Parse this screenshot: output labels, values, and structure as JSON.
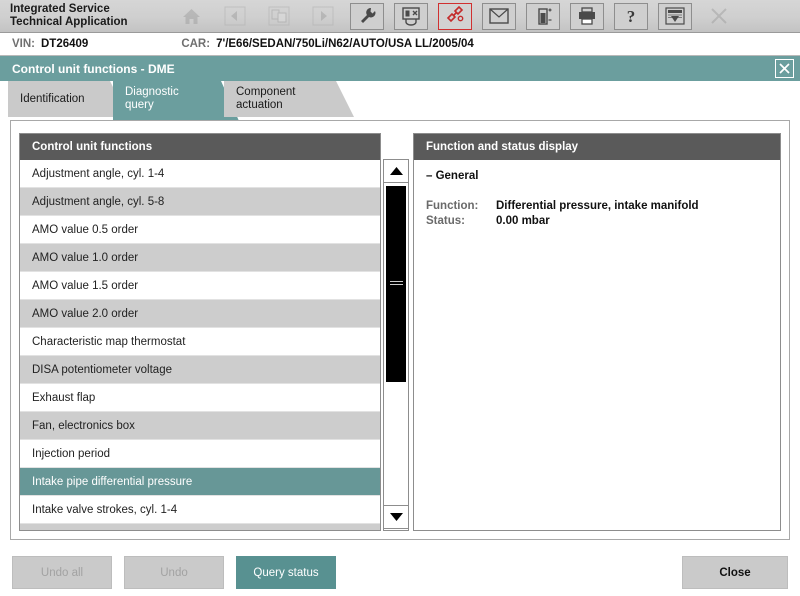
{
  "app": {
    "title": "Integrated Service\nTechnical Application",
    "toolbar": [
      {
        "name": "home-icon",
        "label": "Home",
        "state": "disabled"
      },
      {
        "name": "back-arrow-icon",
        "label": "Back",
        "state": "disabled"
      },
      {
        "name": "documents-icon",
        "label": "Documents",
        "state": "disabled"
      },
      {
        "name": "forward-arrow-icon",
        "label": "Forward",
        "state": "disabled"
      },
      {
        "name": "wrench-icon",
        "label": "Service functions",
        "state": "framed"
      },
      {
        "name": "control-unit-icon",
        "label": "Control unit tree",
        "state": "framed"
      },
      {
        "name": "connector-icon",
        "label": "Connection",
        "state": "active"
      },
      {
        "name": "envelope-icon",
        "label": "Messages",
        "state": "framed"
      },
      {
        "name": "battery-icon",
        "label": "Battery",
        "state": "framed"
      },
      {
        "name": "printer-icon",
        "label": "Print",
        "state": "framed"
      },
      {
        "name": "help-icon",
        "label": "Help",
        "state": "framed"
      },
      {
        "name": "export-icon",
        "label": "Export",
        "state": "framed"
      },
      {
        "name": "close-icon",
        "label": "Exit",
        "state": "disabled"
      }
    ]
  },
  "vehicle": {
    "vin_label": "VIN:",
    "vin_value": "DT26409",
    "car_label": "CAR:",
    "car_value": "7'/E66/SEDAN/750Li/N62/AUTO/USA LL/2005/04"
  },
  "window": {
    "title": "Control unit functions - DME",
    "close_glyph": "✕"
  },
  "tabs": [
    {
      "label": "Identification",
      "active": false
    },
    {
      "label": "Diagnostic\nquery",
      "active": true
    },
    {
      "label": "Component\nactuation",
      "active": false
    }
  ],
  "left_panel": {
    "header": "Control unit functions",
    "items": [
      {
        "label": "Adjustment angle, cyl. 1-4",
        "selected": false
      },
      {
        "label": "Adjustment angle, cyl. 5-8",
        "selected": false
      },
      {
        "label": "AMO value 0.5 order",
        "selected": false
      },
      {
        "label": "AMO value 1.0 order",
        "selected": false
      },
      {
        "label": "AMO value 1.5 order",
        "selected": false
      },
      {
        "label": "AMO value 2.0 order",
        "selected": false
      },
      {
        "label": "Characteristic map thermostat",
        "selected": false
      },
      {
        "label": "DISA potentiometer voltage",
        "selected": false
      },
      {
        "label": "Exhaust flap",
        "selected": false
      },
      {
        "label": "Fan, electronics box",
        "selected": false
      },
      {
        "label": "Injection period",
        "selected": false
      },
      {
        "label": "Intake pipe differential pressure",
        "selected": true
      },
      {
        "label": "Intake valve strokes, cyl. 1-4",
        "selected": false
      },
      {
        "label": "",
        "selected": false
      }
    ]
  },
  "scrollbar": {
    "up_glyph": "▲",
    "down_glyph": "▼"
  },
  "right_panel": {
    "header": "Function and status display",
    "general": "– General",
    "rows": [
      {
        "key": "Function:",
        "value": "Differential pressure, intake manifold"
      },
      {
        "key": "Status:",
        "value": "0.00 mbar"
      }
    ]
  },
  "footer": {
    "undo_all": "Undo all",
    "undo": "Undo",
    "query_status": "Query status",
    "close": "Close"
  },
  "colors": {
    "teal": "#6b9e9e",
    "teal_selected": "#679797",
    "teal_button": "#589191",
    "panel_header": "#5a5a5a",
    "row_alt": "#cdcdcd",
    "accent_red": "#d03030"
  }
}
